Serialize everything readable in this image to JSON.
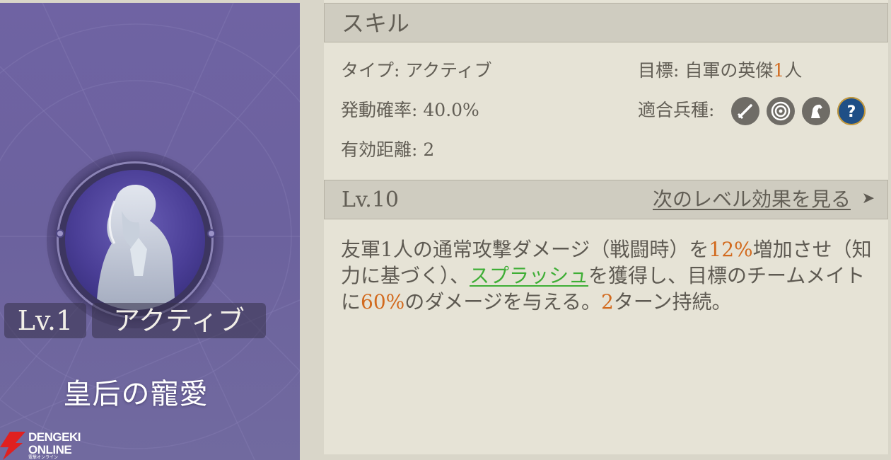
{
  "card": {
    "level": "Lv.1",
    "type": "アクティブ",
    "name": "皇后の寵愛"
  },
  "logo": {
    "line1": "DENGEKI",
    "line2": "ONLINE",
    "line3": "電撃オンライン"
  },
  "skill_header": "スキル",
  "stats": {
    "type_label": "タイプ:",
    "type_value": "アクティブ",
    "target_label": "目標:",
    "target_value_prefix": "自軍の英傑",
    "target_value_count": "1",
    "target_value_suffix": "人",
    "rate_label": "発動確率:",
    "rate_value": "40.0%",
    "units_label": "適合兵種:",
    "range_label": "有効距離:",
    "range_value": "2"
  },
  "unit_icons": [
    "sword-icon",
    "target-icon",
    "horse-icon",
    "question-icon"
  ],
  "level_header": {
    "level": "Lv.10",
    "next_link": "次のレベル効果を見る"
  },
  "description": {
    "p1": "友軍1人の通常攻撃ダメージ（戦闘時）を",
    "v1": "12%",
    "p2": "増加させ（知力に基づく）、",
    "keyword": "スプラッシュ",
    "p3": "を獲得し、目標のチームメイトに",
    "v2": "60%",
    "p4": "のダメージを与える。",
    "v3": "2",
    "p5": "ターン持続。"
  },
  "colors": {
    "highlight_orange": "#d26a1e",
    "highlight_green": "#3fae36",
    "card_purple": "#6f63a3"
  }
}
